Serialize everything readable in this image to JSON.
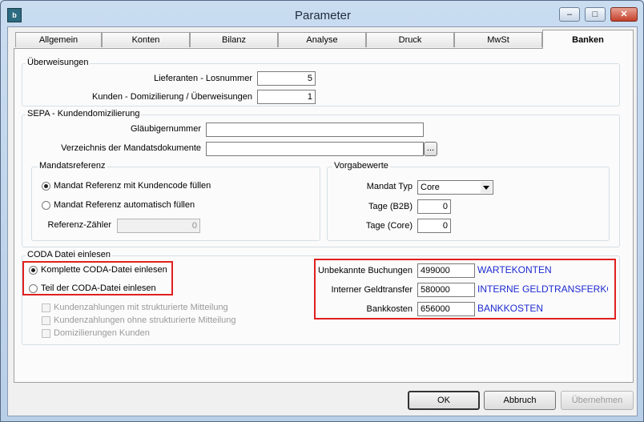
{
  "window": {
    "title": "Parameter",
    "icon_text": "b",
    "minimize": "–",
    "maximize": "□",
    "close": "✕"
  },
  "tabs": [
    {
      "label": "Allgemein"
    },
    {
      "label": "Konten"
    },
    {
      "label": "Bilanz"
    },
    {
      "label": "Analyse"
    },
    {
      "label": "Druck"
    },
    {
      "label": "MwSt"
    },
    {
      "label": "Banken",
      "active": true
    }
  ],
  "ueberweisungen": {
    "legend": "Überweisungen",
    "losnummer_label": "Lieferanten - Losnummer",
    "losnummer_value": "5",
    "domiz_label": "Kunden - Domizilierung / Überweisungen",
    "domiz_value": "1"
  },
  "sepa": {
    "legend": "SEPA - Kundendomizilierung",
    "glaeubiger_label": "Gläubigernummer",
    "glaeubiger_value": "",
    "verzeichnis_label": "Verzeichnis der Mandatsdokumente",
    "verzeichnis_value": "",
    "browse_label": "...",
    "mandat": {
      "legend": "Mandatsreferenz",
      "option1": "Mandat Referenz mit Kundencode füllen",
      "option2": "Mandat Referenz automatisch füllen",
      "zaehler_label": "Referenz-Zähler",
      "zaehler_value": "0"
    },
    "vorgabe": {
      "legend": "Vorgabewerte",
      "typ_label": "Mandat Typ",
      "typ_value": "Core",
      "b2b_label": "Tage (B2B)",
      "b2b_value": "0",
      "core_label": "Tage (Core)",
      "core_value": "0"
    }
  },
  "coda": {
    "legend": "CODA Datei einlesen",
    "option1": "Komplette CODA-Datei einlesen",
    "option2": "Teil der CODA-Datei einlesen",
    "check1": "Kundenzahlungen mit strukturierte Mitteilung",
    "check2": "Kundenzahlungen ohne strukturierte Mitteilung",
    "check3": "Domizilierungen Kunden",
    "rows": [
      {
        "label": "Unbekannte Buchungen",
        "code": "499000",
        "name": "WARTEKONTEN"
      },
      {
        "label": "Interner Geldtransfer",
        "code": "580000",
        "name": "INTERNE GELDTRANSFERKONT"
      },
      {
        "label": "Bankkosten",
        "code": "656000",
        "name": "BANKKOSTEN"
      }
    ]
  },
  "buttons": {
    "ok": "OK",
    "abbruch": "Abbruch",
    "uebernehmen": "Übernehmen"
  },
  "colors": {
    "highlight": "#e02020",
    "account_name": "#1e2bd0"
  }
}
